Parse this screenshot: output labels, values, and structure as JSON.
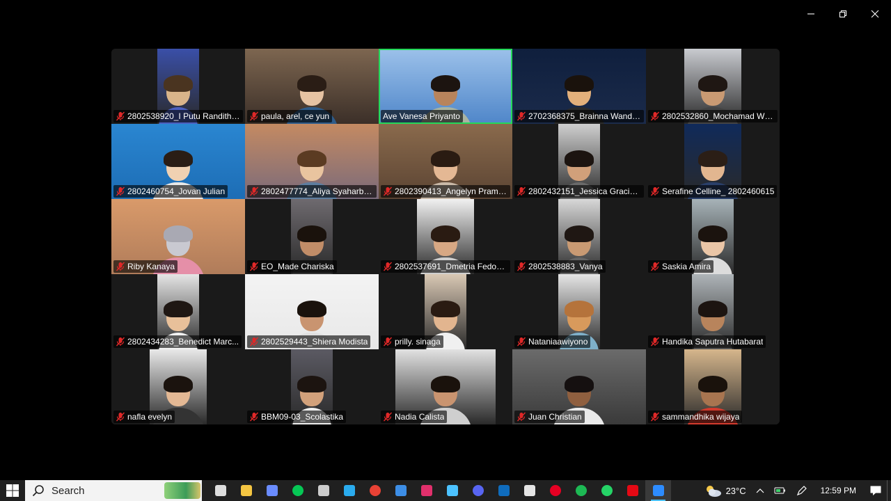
{
  "window": {
    "controls": [
      "minimize",
      "restore",
      "close"
    ]
  },
  "participants": [
    {
      "name": "2802538920_I Putu Randith ...",
      "bg": "#2a2a2a",
      "vid": "#3a4fa8",
      "vw": 60,
      "skin": "#d9b48a",
      "hair": "#4a3420",
      "shirt": "#4b5fc0",
      "muted": true
    },
    {
      "name": "paula, arel, ce yun",
      "bg": "#3b2f28",
      "vid": "#7d6650",
      "vw": 192,
      "skin": "#e6c3a3",
      "hair": "#2a1d15",
      "shirt": "#2f5c8a",
      "muted": true
    },
    {
      "name": "Ave Vanesa Priyanto",
      "bg": "#4f86c9",
      "vid": "#9cc1ea",
      "vw": 192,
      "skin": "#b8845c",
      "hair": "#1c1410",
      "shirt": "#a9b4a2",
      "muted": false,
      "active": true
    },
    {
      "name": "2702368375_Brainna Wandy...",
      "bg": "#1b2b4b",
      "vid": "#0f1f3d",
      "vw": 192,
      "skin": "#e3b07b",
      "hair": "#1a120c",
      "shirt": "#2b2b2b",
      "muted": true
    },
    {
      "name": "2802532860_Mochamad Wil...",
      "bg": "#2a2a2a",
      "vid": "#c9cbd0",
      "vw": 82,
      "skin": "#c99a73",
      "hair": "#1f1713",
      "shirt": "#444",
      "muted": true
    },
    {
      "name": "2802460754_Jovan Julian",
      "bg": "#1d6db5",
      "vid": "#2a86d1",
      "vw": 192,
      "skin": "#f0d1b2",
      "hair": "#2a1d15",
      "shirt": "#e8e8e8",
      "muted": true
    },
    {
      "name": "2802477774_Aliya Syaharba...",
      "bg": "#7a6a7a",
      "vid": "#c48a62",
      "vw": 192,
      "skin": "#e9c49f",
      "hair": "#5b3b22",
      "shirt": "#5e7ea0",
      "muted": true
    },
    {
      "name": "2802390413_Angelyn Prame...",
      "bg": "#5b4433",
      "vid": "#8a6a4c",
      "vw": 192,
      "skin": "#e4b894",
      "hair": "#2a1b12",
      "shirt": "#c9b9a8",
      "muted": true
    },
    {
      "name": "2802432151_Jessica Gracia ...",
      "bg": "#2a2a2a",
      "vid": "#cfcfcf",
      "vw": 60,
      "skin": "#d1a07a",
      "hair": "#1c1410",
      "shirt": "#6a6a6a",
      "muted": true
    },
    {
      "name": "Serafine Celline_ 2802460615",
      "bg": "#2a2a2a",
      "vid": "#102a5a",
      "vw": 82,
      "skin": "#e2b690",
      "hair": "#2b1e16",
      "shirt": "#2a3f6a",
      "muted": true
    },
    {
      "name": "Riby Kanaya",
      "bg": "#b07c5a",
      "vid": "#d99a6a",
      "vw": 192,
      "skin": "#c9c9d1",
      "hair": "#a9a9b3",
      "shirt": "#e58fa8",
      "muted": true
    },
    {
      "name": "EO_Made Chariska",
      "bg": "#2a2a2a",
      "vid": "#6e6a6f",
      "vw": 60,
      "skin": "#c18d68",
      "hair": "#1a120c",
      "shirt": "#333",
      "muted": true
    },
    {
      "name": "2802537691_Dmetria Fedora...",
      "bg": "#2a2a2a",
      "vid": "#f1f1f1",
      "vw": 82,
      "skin": "#d7a884",
      "hair": "#2a1b12",
      "shirt": "#cfcfcf",
      "muted": true
    },
    {
      "name": "2802538883_Vanya",
      "bg": "#2a2a2a",
      "vid": "#d8d8d8",
      "vw": 60,
      "skin": "#c99a73",
      "hair": "#1f1713",
      "shirt": "#666",
      "muted": true
    },
    {
      "name": "Saskia Amira",
      "bg": "#2a2a2a",
      "vid": "#a7b3b8",
      "vw": 60,
      "skin": "#eac6a7",
      "hair": "#1b130e",
      "shirt": "#dcdcdc",
      "muted": true
    },
    {
      "name": "2802434283_Benedict Marc...",
      "bg": "#2a2a2a",
      "vid": "#e5e5e5",
      "vw": 60,
      "skin": "#e8c09a",
      "hair": "#1f1713",
      "shirt": "#f2f2f2",
      "muted": true
    },
    {
      "name": "2802529443_Shiera Modista",
      "bg": "#e8e8e8",
      "vid": "#f3f3f3",
      "vw": 192,
      "skin": "#c99470",
      "hair": "#1a120c",
      "shirt": "#e0e0e0",
      "muted": true
    },
    {
      "name": "prilly. sinaga",
      "bg": "#2a2a2a",
      "vid": "#d9c8b4",
      "vw": 60,
      "skin": "#e2b58f",
      "hair": "#2a1b12",
      "shirt": "#f0f0f0",
      "muted": true
    },
    {
      "name": "Nataniaawiyono",
      "bg": "#2a2a2a",
      "vid": "#e6e6e6",
      "vw": 60,
      "skin": "#d89a5c",
      "hair": "#b5733b",
      "shirt": "#7fb0c9",
      "muted": true
    },
    {
      "name": "Handika Saputra Hutabarat",
      "bg": "#2a2a2a",
      "vid": "#aeb4b8",
      "vw": 60,
      "skin": "#b8845c",
      "hair": "#1c1410",
      "shirt": "#555",
      "muted": true
    },
    {
      "name": "nafla evelyn",
      "bg": "#2a2a2a",
      "vid": "#e9e9e9",
      "vw": 82,
      "skin": "#e3b894",
      "hair": "#1b130e",
      "shirt": "#333",
      "muted": true
    },
    {
      "name": "BBM09-03_Scolastika",
      "bg": "#2a2a2a",
      "vid": "#5b5a63",
      "vw": 60,
      "skin": "#d2a17b",
      "hair": "#1c1410",
      "shirt": "#ededed",
      "muted": true
    },
    {
      "name": "Nadia Calista",
      "bg": "#2a2a2a",
      "vid": "#e2e2e2",
      "vw": 144,
      "skin": "#c99470",
      "hair": "#1a120c",
      "shirt": "#cfcfcf",
      "muted": true
    },
    {
      "name": "Juan Christian",
      "bg": "#3a3a3a",
      "vid": "#6b6b6b",
      "vw": 192,
      "skin": "#8f5f3f",
      "hair": "#151010",
      "shirt": "#eaeaea",
      "muted": true
    },
    {
      "name": "sammandhika wijaya",
      "bg": "#2a2a2a",
      "vid": "#d6b68c",
      "vw": 82,
      "skin": "#a87550",
      "hair": "#1a120c",
      "shirt": "#d33b2e",
      "muted": true
    }
  ],
  "taskbar": {
    "search_label": "Search",
    "apps": [
      {
        "name": "task-view",
        "color": "#dddddd"
      },
      {
        "name": "file-explorer",
        "color": "#f4c542"
      },
      {
        "name": "copilot",
        "color": "#6a8cff"
      },
      {
        "name": "line",
        "color": "#06c755"
      },
      {
        "name": "camera",
        "color": "#cccccc"
      },
      {
        "name": "telegram",
        "color": "#2aabee"
      },
      {
        "name": "chrome",
        "color": "#e94235"
      },
      {
        "name": "photos",
        "color": "#3d8ee6"
      },
      {
        "name": "instagram",
        "color": "#e1306c"
      },
      {
        "name": "snipping-tool",
        "color": "#4cc2ff"
      },
      {
        "name": "discord",
        "color": "#5865f2"
      },
      {
        "name": "mail",
        "color": "#0f6cbd"
      },
      {
        "name": "roblox",
        "color": "#e5e5e5"
      },
      {
        "name": "pinterest",
        "color": "#e60023"
      },
      {
        "name": "spotify",
        "color": "#1db954"
      },
      {
        "name": "whatsapp",
        "color": "#25d366"
      },
      {
        "name": "netflix",
        "color": "#e50914"
      },
      {
        "name": "zoom",
        "color": "#2d8cff"
      }
    ],
    "active_app": "zoom",
    "temperature": "23°C",
    "time": "12:59 PM"
  }
}
